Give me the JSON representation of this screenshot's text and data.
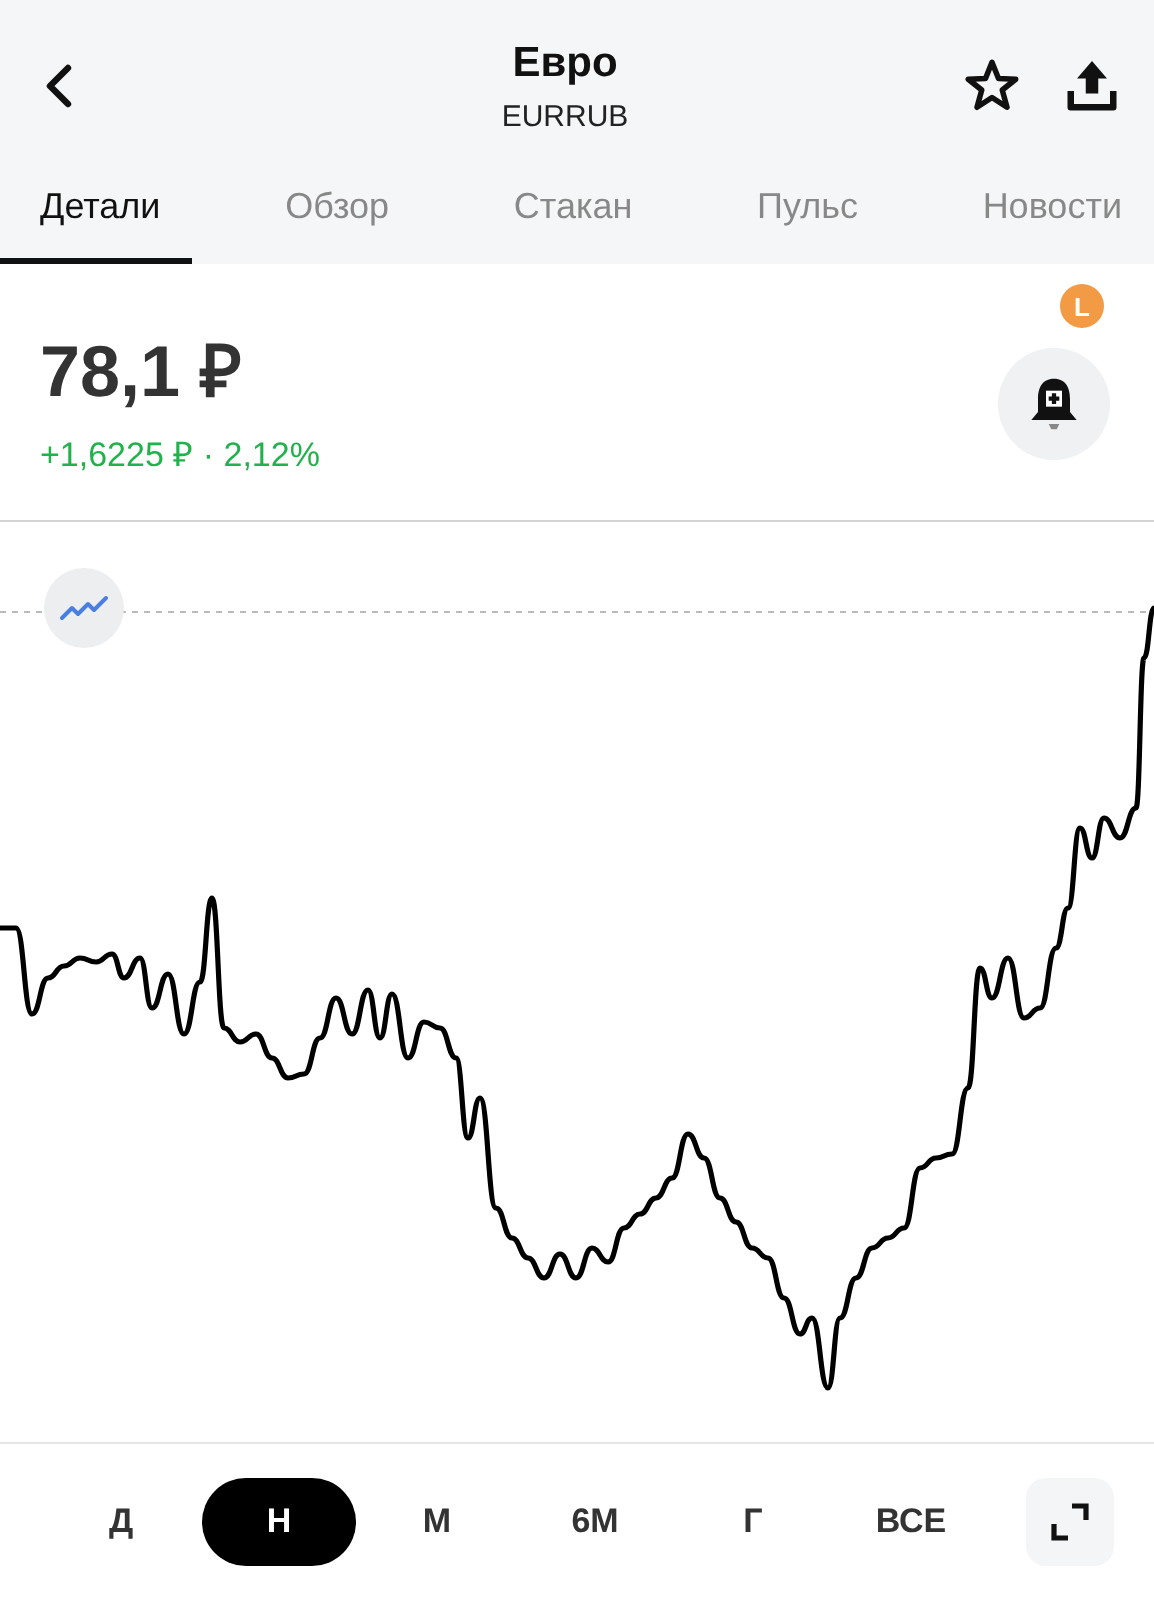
{
  "header": {
    "title": "Евро",
    "subtitle": "EURRUB"
  },
  "tabs": [
    {
      "label": "Детали",
      "selected": true
    },
    {
      "label": "Обзор",
      "selected": false
    },
    {
      "label": "Стакан",
      "selected": false
    },
    {
      "label": "Пульс",
      "selected": false
    },
    {
      "label": "Новости",
      "selected": false
    }
  ],
  "quote": {
    "price": "78,1 ₽",
    "change": "+1,6225 ₽ · 2,12%",
    "badge": "L"
  },
  "periods": [
    {
      "label": "Д",
      "selected": false
    },
    {
      "label": "Н",
      "selected": true
    },
    {
      "label": "М",
      "selected": false
    },
    {
      "label": "6М",
      "selected": false
    },
    {
      "label": "Г",
      "selected": false
    },
    {
      "label": "ВСЕ",
      "selected": false
    }
  ]
}
